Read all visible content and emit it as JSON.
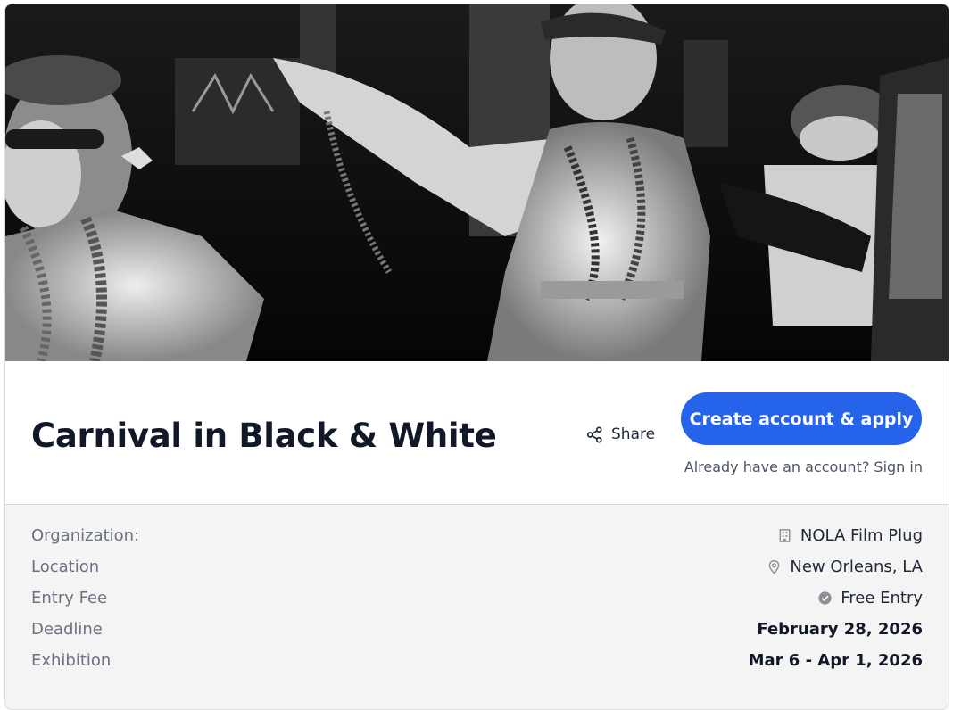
{
  "event": {
    "title": "Carnival in Black & White",
    "hero_alt": "Black and white photo of carnival revelers wearing beads"
  },
  "actions": {
    "share_label": "Share",
    "apply_label": "Create account & apply",
    "signin_text": "Already have an account? Sign in"
  },
  "details": {
    "rows": [
      {
        "label": "Organization:",
        "value": "NOLA Film Plug",
        "icon": "building-icon"
      },
      {
        "label": "Location",
        "value": "New Orleans, LA",
        "icon": "map-pin-icon"
      },
      {
        "label": "Entry Fee",
        "value": "Free Entry",
        "icon": "check-circle-icon"
      },
      {
        "label": "Deadline",
        "value": "February 28, 2026",
        "icon": ""
      },
      {
        "label": "Exhibition",
        "value": "Mar 6 - Apr 1, 2026",
        "icon": ""
      }
    ]
  },
  "colors": {
    "accent": "#2563eb",
    "title": "#111827",
    "label": "#6b7280",
    "details_bg": "#f4f4f4"
  }
}
